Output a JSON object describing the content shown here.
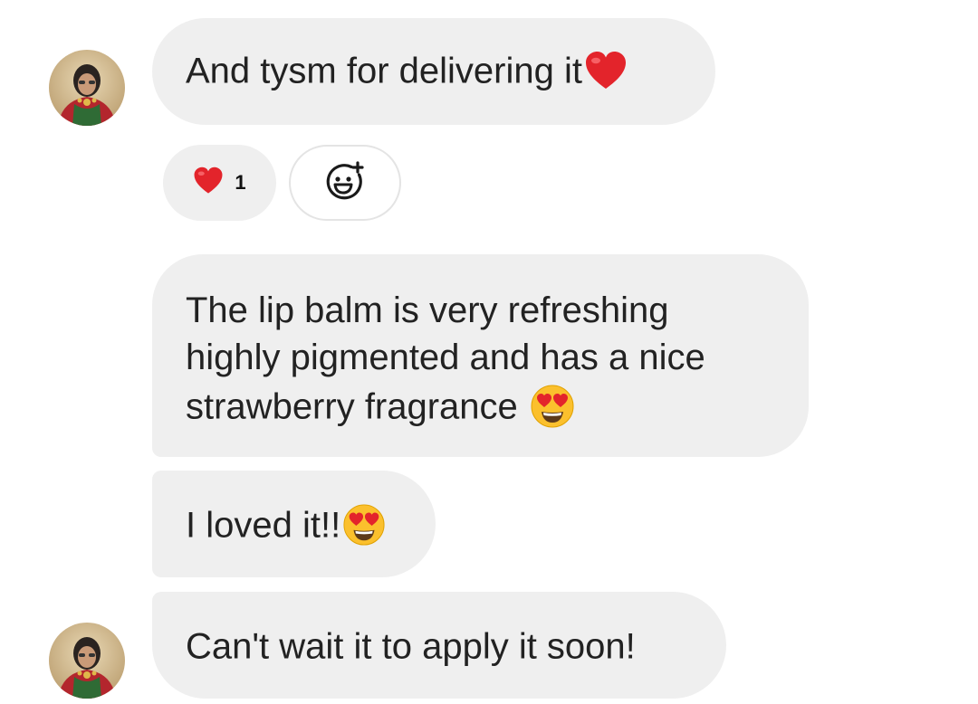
{
  "messages": [
    {
      "text": "And tysm for delivering it",
      "trailing_emoji": "heart-emoji"
    },
    {
      "lines": [
        "The lip balm is very refreshing",
        "highly pigmented and has a nice",
        "strawberry fragrance "
      ],
      "trailing_emoji": "heart-eyes-emoji"
    },
    {
      "text": "I loved it!!",
      "trailing_emoji": "heart-eyes-emoji"
    },
    {
      "text": "Can't wait it to apply it soon!"
    }
  ],
  "reactions": [
    {
      "emoji": "heart-emoji",
      "count": "1"
    },
    {
      "icon": "add-reaction-icon"
    }
  ],
  "colors": {
    "bubble_bg": "#efefef",
    "text": "#222222",
    "heart": "#e3242b",
    "emoji_face": "#fbc02d"
  }
}
